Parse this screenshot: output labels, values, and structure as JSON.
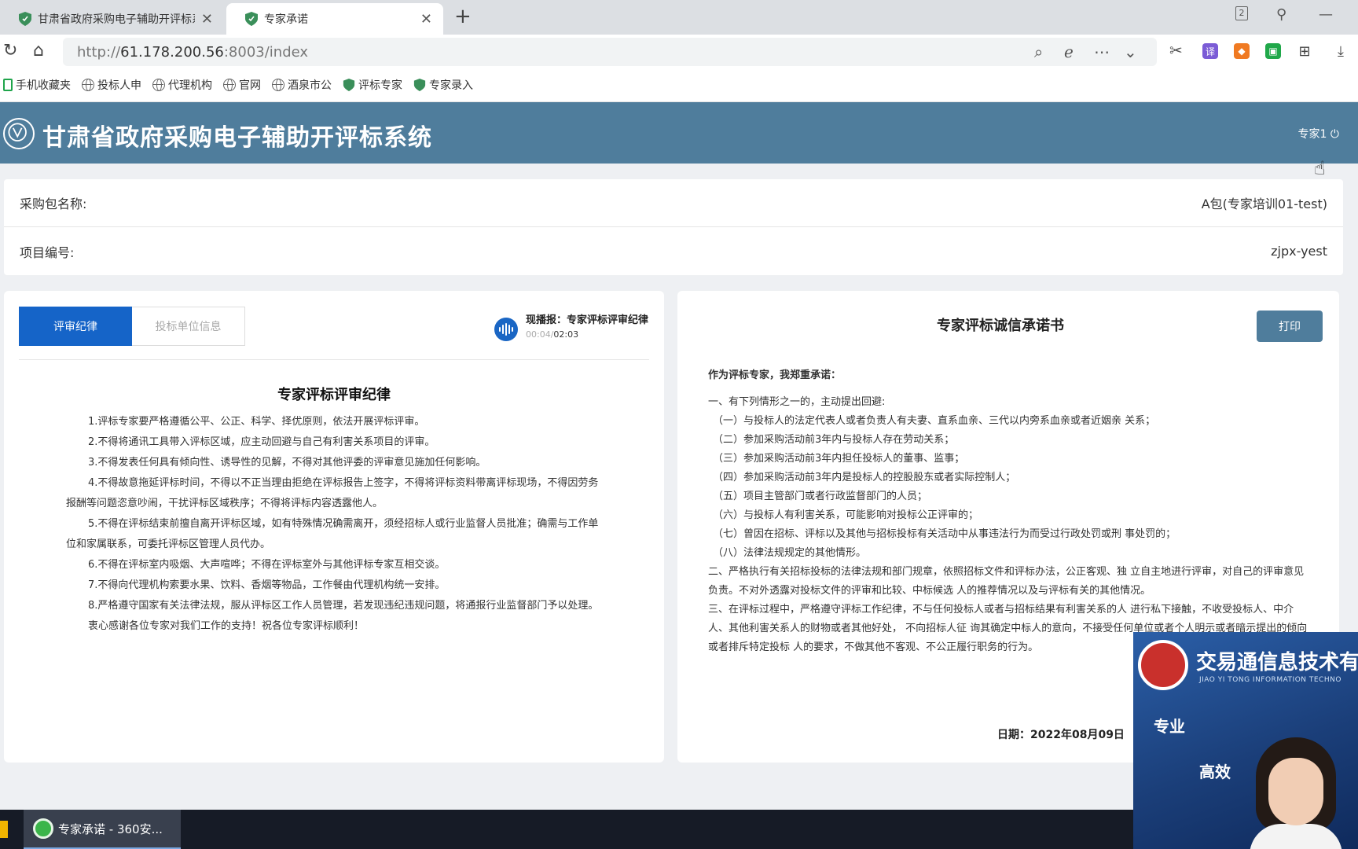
{
  "browser": {
    "tabs": [
      {
        "title": "甘肃省政府采购电子辅助开评标系统",
        "active": false
      },
      {
        "title": "专家承诺",
        "active": true
      }
    ],
    "tab_counter": "2",
    "url_prefix": "http://",
    "url_host": "61.178.200.56",
    "url_rest": ":8003/index",
    "bookmarks": [
      "手机收藏夹",
      "投标人申",
      "代理机构",
      "官网",
      "酒泉市公",
      "评标专家",
      "专家录入"
    ]
  },
  "app": {
    "title": "甘肃省政府采购电子辅助开评标系统",
    "user": "专家1"
  },
  "info": {
    "package_label": "采购包名称:",
    "package_value": "A包(专家培训01-test)",
    "project_label": "项目编号:",
    "project_value": "zjpx-yest"
  },
  "left": {
    "tabs": [
      "评审纪律",
      "投标单位信息"
    ],
    "player": {
      "title": "现播报：专家评标评审纪律",
      "elapsed": "00:04",
      "total": "02:03"
    },
    "rules_title": "专家评标评审纪律",
    "rules": [
      "1.评标专家要严格遵循公平、公正、科学、择优原则，依法开展评标评审。",
      "2.不得将通讯工具带入评标区域，应主动回避与自己有利害关系项目的评审。",
      "3.不得发表任何具有倾向性、诱导性的见解，不得对其他评委的评审意见施加任何影响。",
      "4.不得故意拖延评标时间，不得以不正当理由拒绝在评标报告上签字，不得将评标资料带离评标现场，不得因劳务报酬等问题恣意吵闹，干扰评标区域秩序；不得将评标内容透露他人。",
      "5.不得在评标结束前擅自离开评标区域，如有特殊情况确需离开，须经招标人或行业监督人员批准；确需与工作单位和家属联系，可委托评标区管理人员代办。",
      "6.不得在评标室内吸烟、大声喧哗；不得在评标室外与其他评标专家互相交谈。",
      "7.不得向代理机构索要水果、饮料、香烟等物品，工作餐由代理机构统一安排。",
      "8.严格遵守国家有关法律法规，服从评标区工作人员管理，若发现违纪违规问题，将通报行业监督部门予以处理。",
      "衷心感谢各位专家对我们工作的支持！祝各位专家评标顺利！"
    ]
  },
  "right": {
    "title": "专家评标诚信承诺书",
    "print_label": "打印",
    "lead": "作为评标专家，我郑重承诺：",
    "section1": "一、有下列情形之一的，主动提出回避:",
    "items": [
      "（一）与投标人的法定代表人或者负责人有夫妻、直系血亲、三代以内旁系血亲或者近姻亲 关系；",
      "（二）参加采购活动前3年内与投标人存在劳动关系；",
      "（三）参加采购活动前3年内担任投标人的董事、监事；",
      "（四）参加采购活动前3年内是投标人的控股股东或者实际控制人；",
      "（五）项目主管部门或者行政监督部门的人员；",
      "（六）与投标人有利害关系，可能影响对投标公正评审的；",
      "（七）曾因在招标、评标以及其他与招标投标有关活动中从事违法行为而受过行政处罚或刑 事处罚的；",
      "（八）法律法规规定的其他情形。"
    ],
    "section2": "二、严格执行有关招标投标的法律法规和部门规章，依照招标文件和评标办法，公正客观、独 立自主地进行评审，对自己的评审意见负责。不对外透露对投标文件的评审和比较、中标候选 人的推荐情况以及与评标有关的其他情况。",
    "section3": "三、在评标过程中，严格遵守评标工作纪律，不与任何投标人或者与招标结果有利害关系的人 进行私下接触，不收受投标人、中介人、其他利害关系人的财物或者其他好处， 不向招标人征 询其确定中标人的意向，不接受任何单位或者个人明示或者暗示提出的倾向或者排斥特定投标 人的要求，不做其他不客观、不公正履行职务的行为。",
    "date": "日期：2022年08月09日"
  },
  "video": {
    "company": "交易通信息技术有",
    "company_en": "JIAO YI TONG INFORMATION TECHNO",
    "word1": "专业",
    "word2": "高效"
  },
  "taskbar": {
    "app_label": "专家承诺 - 360安..."
  },
  "colors": {
    "header": "#4f7d9c",
    "tab_active": "#1564c8",
    "print_button": "#4f7d9c"
  }
}
